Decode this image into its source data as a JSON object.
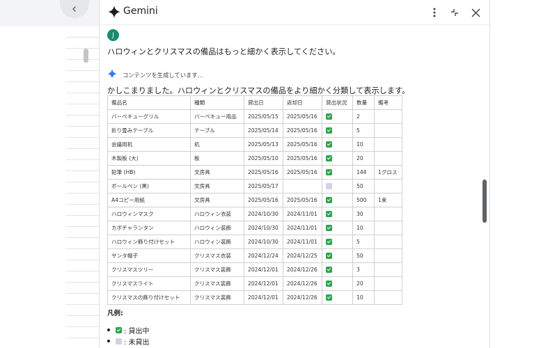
{
  "header": {
    "title": "Gemini"
  },
  "user": {
    "avatar_letter": "J",
    "message": "ハロウィンとクリスマスの備品はもっと細かく表示してください。"
  },
  "status": {
    "generating_text": "コンテンツを生成しています..."
  },
  "reply": {
    "intro": "かしこまりました。ハロウィンとクリスマスの備品をより細かく分類して表示します。"
  },
  "table": {
    "columns": [
      "備品名",
      "種類",
      "貸出日",
      "返却日",
      "貸出状況",
      "数量",
      "備考"
    ],
    "rows": [
      {
        "name": "バーベキューグリル",
        "type": "バーベキュー用品",
        "lend": "2025/05/15",
        "return": "2025/05/16",
        "status": "lent",
        "qty": "2",
        "note": ""
      },
      {
        "name": "折り畳みテーブル",
        "type": "テーブル",
        "lend": "2025/05/14",
        "return": "2025/05/16",
        "status": "lent",
        "qty": "5",
        "note": ""
      },
      {
        "name": "会議用机",
        "type": "机",
        "lend": "2025/05/13",
        "return": "2025/05/16",
        "status": "lent",
        "qty": "10",
        "note": ""
      },
      {
        "name": "木製板 (大)",
        "type": "板",
        "lend": "2025/05/10",
        "return": "2025/05/16",
        "status": "lent",
        "qty": "20",
        "note": ""
      },
      {
        "name": "鉛筆 (HB)",
        "type": "文房具",
        "lend": "2025/05/16",
        "return": "2025/05/16",
        "status": "lent",
        "qty": "144",
        "note": "1グロス"
      },
      {
        "name": "ボールペン (黒)",
        "type": "文房具",
        "lend": "2025/05/17",
        "return": "",
        "status": "not_lent",
        "qty": "50",
        "note": ""
      },
      {
        "name": "A4コピー用紙",
        "type": "文房具",
        "lend": "2025/05/16",
        "return": "2025/05/16",
        "status": "lent",
        "qty": "500",
        "note": "1束"
      },
      {
        "name": "ハロウィンマスク",
        "type": "ハロウィン衣装",
        "lend": "2024/10/30",
        "return": "2024/11/01",
        "status": "lent",
        "qty": "30",
        "note": ""
      },
      {
        "name": "カボチャランタン",
        "type": "ハロウィン装飾",
        "lend": "2024/10/30",
        "return": "2024/11/01",
        "status": "lent",
        "qty": "10",
        "note": ""
      },
      {
        "name": "ハロウィン飾り付けセット",
        "type": "ハロウィン装飾",
        "lend": "2024/10/30",
        "return": "2024/11/01",
        "status": "lent",
        "qty": "5",
        "note": ""
      },
      {
        "name": "サンタ帽子",
        "type": "クリスマス衣装",
        "lend": "2024/12/24",
        "return": "2024/12/25",
        "status": "lent",
        "qty": "50",
        "note": ""
      },
      {
        "name": "クリスマスツリー",
        "type": "クリスマス装飾",
        "lend": "2024/12/01",
        "return": "2024/12/26",
        "status": "lent",
        "qty": "3",
        "note": ""
      },
      {
        "name": "クリスマスライト",
        "type": "クリスマス装飾",
        "lend": "2024/12/01",
        "return": "2024/12/26",
        "status": "lent",
        "qty": "20",
        "note": ""
      },
      {
        "name": "クリスマスの飾り付けセット",
        "type": "クリスマス装飾",
        "lend": "2024/12/01",
        "return": "2024/12/26",
        "status": "lent",
        "qty": "10",
        "note": ""
      }
    ]
  },
  "legend": {
    "title": "凡例:",
    "items": [
      {
        "icon": "check-box-icon",
        "text": ": 貸出中"
      },
      {
        "icon": "empty-box-icon",
        "text": ": 未貸出"
      }
    ]
  },
  "colors": {
    "avatar": "#1b8a73",
    "check": "#2ea44f",
    "unchecked": "#d9cde8",
    "spark_blue": "#3b82f6"
  }
}
